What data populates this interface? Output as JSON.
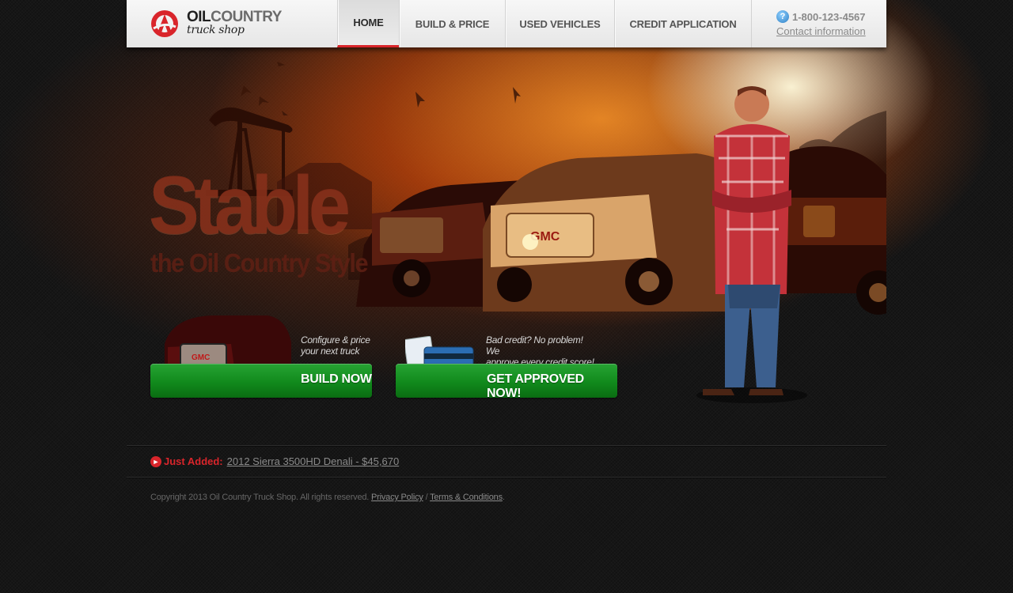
{
  "brand": {
    "name_oil": "OIL",
    "name_country": "COUNTRY",
    "subtitle": "truck shop"
  },
  "nav": {
    "home": "HOME",
    "build_price": "BUILD & PRICE",
    "used_vehicles": "USED VEHICLES",
    "credit_application": "CREDIT APPLICATION",
    "active": "HOME"
  },
  "contact": {
    "phone": "1-800-123-4567",
    "link": "Contact information"
  },
  "hero": {
    "headline": "Stable",
    "tagline": "the Oil Country Style"
  },
  "cta_build": {
    "description_line1": "Configure & price",
    "description_line2": "your next truck",
    "button": "BUILD NOW"
  },
  "cta_credit": {
    "description_line1": "Bad credit? No problem! We",
    "description_line2": "approve every credit score!",
    "button": "GET APPROVED NOW!"
  },
  "just_added": {
    "label": "Just Added:",
    "link": "2012 Sierra 3500HD Denali - $45,670"
  },
  "footer": {
    "copyright": "Copyright 2013 Oil Country Truck Shop. All rights reserved.",
    "privacy": "Privacy Policy",
    "separator": "/",
    "terms": "Terms & Conditions",
    "end": "."
  },
  "colors": {
    "accent_red": "#d9252b",
    "button_green": "#118a1c",
    "header_bg": "#eeeeee",
    "page_bg": "#161616"
  },
  "icons": [
    "logo-mark-icon",
    "help-icon",
    "arrow-right-icon",
    "credit-card-icon"
  ]
}
